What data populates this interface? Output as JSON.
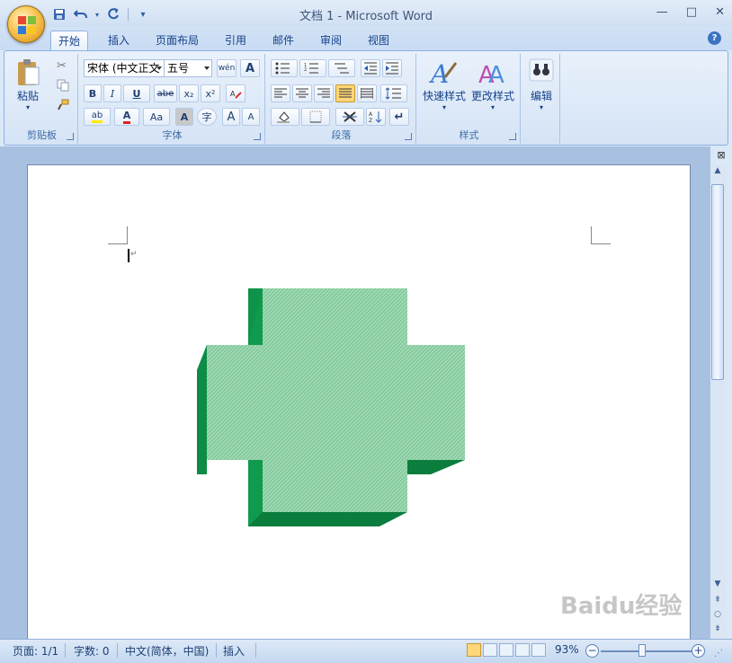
{
  "window": {
    "title": "文档 1 - Microsoft Word",
    "minimize": "—",
    "maximize": "□",
    "close": "✕"
  },
  "qat": {
    "save_icon": "save-icon",
    "undo_icon": "undo-icon",
    "redo_icon": "redo-icon",
    "customize": "▾"
  },
  "tabs": [
    {
      "label": "开始",
      "active": true
    },
    {
      "label": "插入"
    },
    {
      "label": "页面布局"
    },
    {
      "label": "引用"
    },
    {
      "label": "邮件"
    },
    {
      "label": "审阅"
    },
    {
      "label": "视图"
    }
  ],
  "ribbon": {
    "clipboard": {
      "label": "剪贴板",
      "paste": "粘贴"
    },
    "font": {
      "label": "字体",
      "font_name": "宋体 (中文正文",
      "font_size": "五号",
      "wen": "wén",
      "bold": "B",
      "italic": "I",
      "underline": "U",
      "strike": "abe",
      "sub": "x₂",
      "sup": "x²",
      "aa": "Aa",
      "grow": "A",
      "shrink": "A",
      "char_shade": "A",
      "enclose": "字",
      "box": "A"
    },
    "paragraph": {
      "label": "段落"
    },
    "styles": {
      "label": "样式",
      "quick": "快速样式",
      "change": "更改样式"
    },
    "editing": {
      "label": "编辑"
    }
  },
  "status": {
    "page": "页面: 1/1",
    "words": "字数: 0",
    "lang": "中文(简体，中国)",
    "mode": "插入",
    "zoom": "93%"
  },
  "shape": {
    "type": "3d-plus-sign",
    "face_color": "#8fcfa6",
    "side_color": "#0a9048",
    "pattern": "fine-hatch"
  },
  "watermark": "Baidu经验"
}
